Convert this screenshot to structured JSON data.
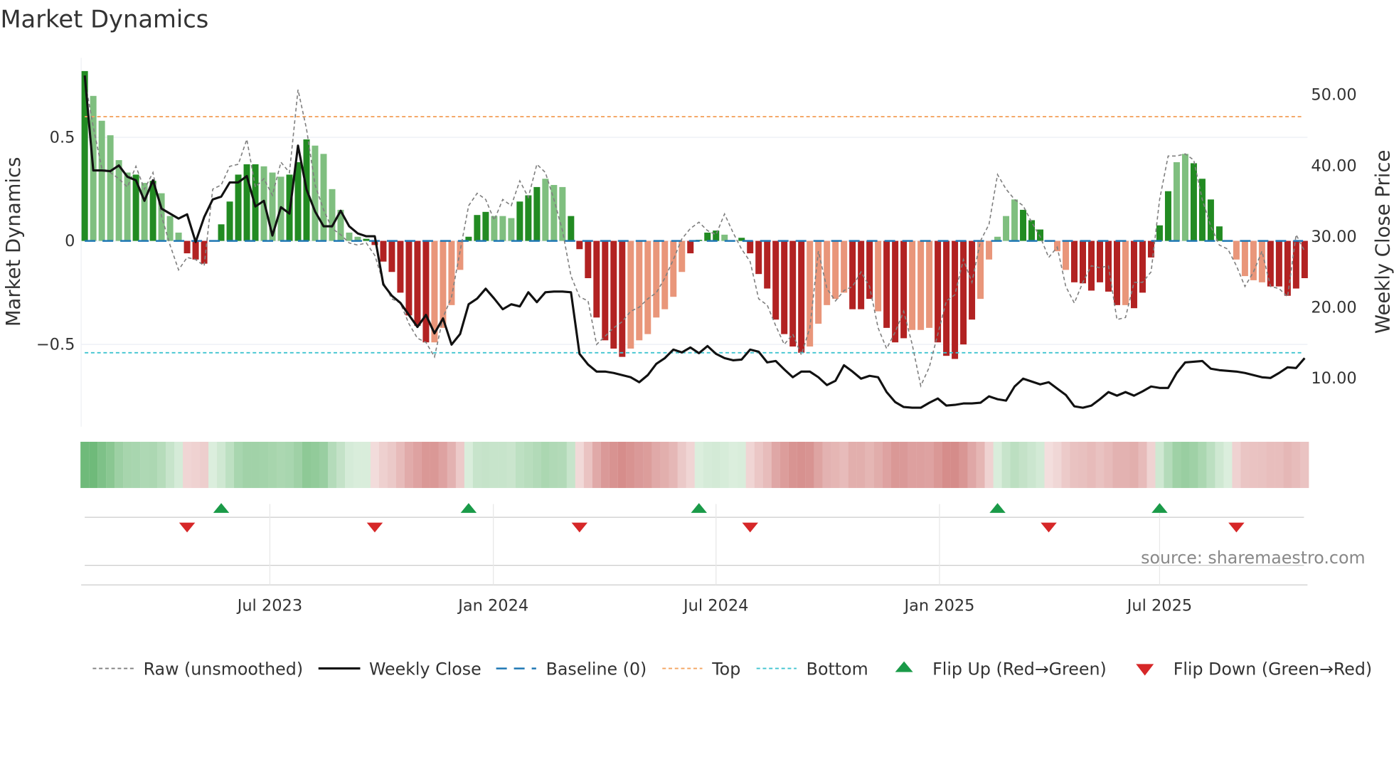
{
  "chart_data": {
    "type": "bar",
    "title": "Market Dynamics",
    "ylabel": "Market Dynamics",
    "y2label": "Weekly Close Price",
    "ylim": [
      -0.9,
      0.88
    ],
    "y2lim": [
      2.3,
      56.8
    ],
    "yticks": [
      {
        "v": 0.5,
        "label": "0.5"
      },
      {
        "v": 0,
        "label": "0"
      },
      {
        "v": -0.5,
        "label": "−0.5"
      }
    ],
    "y2ticks": [
      {
        "v": 50,
        "label": "50.00"
      },
      {
        "v": 40,
        "label": "40.00"
      },
      {
        "v": 30,
        "label": "30.00"
      },
      {
        "v": 20,
        "label": "20.00"
      },
      {
        "v": 10,
        "label": "10.00"
      }
    ],
    "xticks": [
      {
        "week": 21.7,
        "label": "Jul 2023"
      },
      {
        "week": 47.9,
        "label": "Jan 2024"
      },
      {
        "week": 74,
        "label": "Jul 2024"
      },
      {
        "week": 100.2,
        "label": "Jan 2025"
      },
      {
        "week": 126,
        "label": "Jul 2025"
      }
    ],
    "top_level": 0.6,
    "bottom_level": -0.54,
    "baseline": 0,
    "values": [
      0.82,
      0.7,
      0.58,
      0.51,
      0.39,
      0.33,
      0.32,
      0.28,
      0.29,
      0.23,
      0.12,
      0.04,
      -0.06,
      -0.09,
      -0.11,
      0.0,
      0.08,
      0.19,
      0.32,
      0.37,
      0.37,
      0.36,
      0.33,
      0.31,
      0.32,
      0.38,
      0.49,
      0.46,
      0.42,
      0.25,
      0.15,
      0.04,
      0.02,
      0.01,
      -0.02,
      -0.1,
      -0.15,
      -0.25,
      -0.36,
      -0.41,
      -0.49,
      -0.49,
      -0.42,
      -0.31,
      -0.14,
      0.02,
      0.125,
      0.14,
      0.12,
      0.12,
      0.11,
      0.19,
      0.22,
      0.26,
      0.3,
      0.27,
      0.26,
      0.12,
      -0.04,
      -0.18,
      -0.37,
      -0.48,
      -0.52,
      -0.56,
      -0.52,
      -0.48,
      -0.45,
      -0.37,
      -0.33,
      -0.27,
      -0.15,
      -0.06,
      0.005,
      0.04,
      0.05,
      0.03,
      0.0,
      0.015,
      -0.06,
      -0.16,
      -0.23,
      -0.38,
      -0.45,
      -0.51,
      -0.54,
      -0.51,
      -0.4,
      -0.31,
      -0.28,
      -0.25,
      -0.33,
      -0.33,
      -0.28,
      -0.34,
      -0.42,
      -0.49,
      -0.47,
      -0.43,
      -0.43,
      -0.42,
      -0.49,
      -0.555,
      -0.57,
      -0.5,
      -0.38,
      -0.28,
      -0.09,
      0.02,
      0.12,
      0.2,
      0.15,
      0.1,
      0.055,
      -0.005,
      -0.05,
      -0.14,
      -0.2,
      -0.205,
      -0.24,
      -0.2,
      -0.245,
      -0.31,
      -0.31,
      -0.325,
      -0.25,
      -0.08,
      0.075,
      0.24,
      0.38,
      0.42,
      0.375,
      0.3,
      0.2,
      0.07,
      0.0,
      -0.09,
      -0.17,
      -0.19,
      -0.2,
      -0.22,
      -0.22,
      -0.265,
      -0.23,
      -0.18
    ],
    "shades": "dllllldldllldddldddd1llldddllllllddddddddlllldddllldddllldddddddlllllllddd1ldddddddddllllldddldddllldddddllllldddlll1dddddldddddlldddddllll1dddddldll",
    "raw": [
      0.78,
      0.55,
      0.35,
      0.33,
      0.3,
      0.26,
      0.36,
      0.25,
      0.33,
      0.12,
      -0.02,
      -0.14,
      -0.08,
      -0.09,
      -0.12,
      0.25,
      0.27,
      0.36,
      0.37,
      0.49,
      0.26,
      0.3,
      0.22,
      0.38,
      0.33,
      0.73,
      0.54,
      0.27,
      0.15,
      0.06,
      0.03,
      -0.01,
      -0.02,
      -0.01,
      -0.07,
      -0.2,
      -0.28,
      -0.3,
      -0.4,
      -0.47,
      -0.49,
      -0.56,
      -0.37,
      -0.27,
      -0.05,
      0.17,
      0.23,
      0.2,
      0.1,
      0.2,
      0.17,
      0.29,
      0.21,
      0.37,
      0.33,
      0.2,
      0.05,
      -0.17,
      -0.27,
      -0.29,
      -0.5,
      -0.46,
      -0.42,
      -0.39,
      -0.34,
      -0.32,
      -0.28,
      -0.25,
      -0.18,
      -0.09,
      0.01,
      0.06,
      0.09,
      0.05,
      0.03,
      0.13,
      0.04,
      -0.04,
      -0.1,
      -0.28,
      -0.31,
      -0.41,
      -0.5,
      -0.45,
      -0.55,
      -0.42,
      -0.05,
      -0.23,
      -0.29,
      -0.24,
      -0.22,
      -0.15,
      -0.22,
      -0.42,
      -0.52,
      -0.44,
      -0.34,
      -0.5,
      -0.7,
      -0.61,
      -0.45,
      -0.29,
      -0.26,
      -0.09,
      -0.2,
      0.0,
      0.08,
      0.32,
      0.25,
      0.2,
      0.17,
      0.09,
      0.02,
      -0.08,
      -0.03,
      -0.22,
      -0.3,
      -0.2,
      -0.12,
      -0.13,
      -0.12,
      -0.38,
      -0.37,
      -0.2,
      -0.2,
      -0.15,
      0.2,
      0.41,
      0.41,
      0.42,
      0.39,
      0.2,
      0.07,
      -0.02,
      -0.04,
      -0.12,
      -0.22,
      -0.15,
      -0.05,
      -0.22,
      -0.23,
      -0.27,
      0.03,
      -0.05
    ],
    "close": [
      52.6,
      39.2,
      39.2,
      39.1,
      39.9,
      38.3,
      37.8,
      34.9,
      37.8,
      33.8,
      33.1,
      32.4,
      33.0,
      29.1,
      32.6,
      35.1,
      35.5,
      37.5,
      37.5,
      38.4,
      34.1,
      34.9,
      30.0,
      34.0,
      33.1,
      42.7,
      36.5,
      33.4,
      31.3,
      31.3,
      33.5,
      31.3,
      30.3,
      29.9,
      29.9,
      23.1,
      21.5,
      20.5,
      18.8,
      17.1,
      18.8,
      16.2,
      18.3,
      14.6,
      16.1,
      20.3,
      21.1,
      22.5,
      21.1,
      19.6,
      20.3,
      20.0,
      22.0,
      20.6,
      22.0,
      22.1,
      22.1,
      22.0,
      13.3,
      11.8,
      10.8,
      10.8,
      10.6,
      10.3,
      10.0,
      9.3,
      10.3,
      11.9,
      12.7,
      13.9,
      13.5,
      14.2,
      13.4,
      14.4,
      13.3,
      12.7,
      12.4,
      12.5,
      13.9,
      13.6,
      12.1,
      12.3,
      11.1,
      10.0,
      10.8,
      10.8,
      10.0,
      8.9,
      9.5,
      11.7,
      10.8,
      9.8,
      10.2,
      10.0,
      7.9,
      6.5,
      5.8,
      5.7,
      5.7,
      6.4,
      7.0,
      6.0,
      6.1,
      6.3,
      6.3,
      6.4,
      7.3,
      6.9,
      6.7,
      8.7,
      9.8,
      9.4,
      9.0,
      9.3,
      8.4,
      7.5,
      5.9,
      5.7,
      6.0,
      6.9,
      7.9,
      7.4,
      7.9,
      7.4,
      8.0,
      8.7,
      8.5,
      8.5,
      10.6,
      12.1,
      12.2,
      12.3,
      11.2,
      11.0,
      10.9,
      10.8,
      10.6,
      10.3,
      10.0,
      9.9,
      10.6,
      11.4,
      11.3,
      12.7
    ],
    "flip_up": [
      16,
      45,
      72,
      107,
      126
    ],
    "flip_down": [
      12,
      34,
      58,
      78,
      113,
      135
    ],
    "colors": {
      "dark_green": "#228b22",
      "light_green": "#7fbf7f",
      "dark_red": "#b22222",
      "light_red": "#e9967a",
      "baseline": "#1f77b4",
      "top": "#f4a460",
      "bottom": "#40c4d0",
      "flip_up": "#1a9a48",
      "flip_down": "#d62728"
    },
    "legend": {
      "placement": "bottom",
      "raw": "Raw (unsmoothed)",
      "close": "Weekly Close",
      "baseline": "Baseline (0)",
      "top": "Top",
      "bottom": "Bottom",
      "flip_up": "Flip Up (Red→Green)",
      "flip_down": "Flip Down (Green→Red)"
    },
    "source": "source: sharemaestro.com"
  }
}
